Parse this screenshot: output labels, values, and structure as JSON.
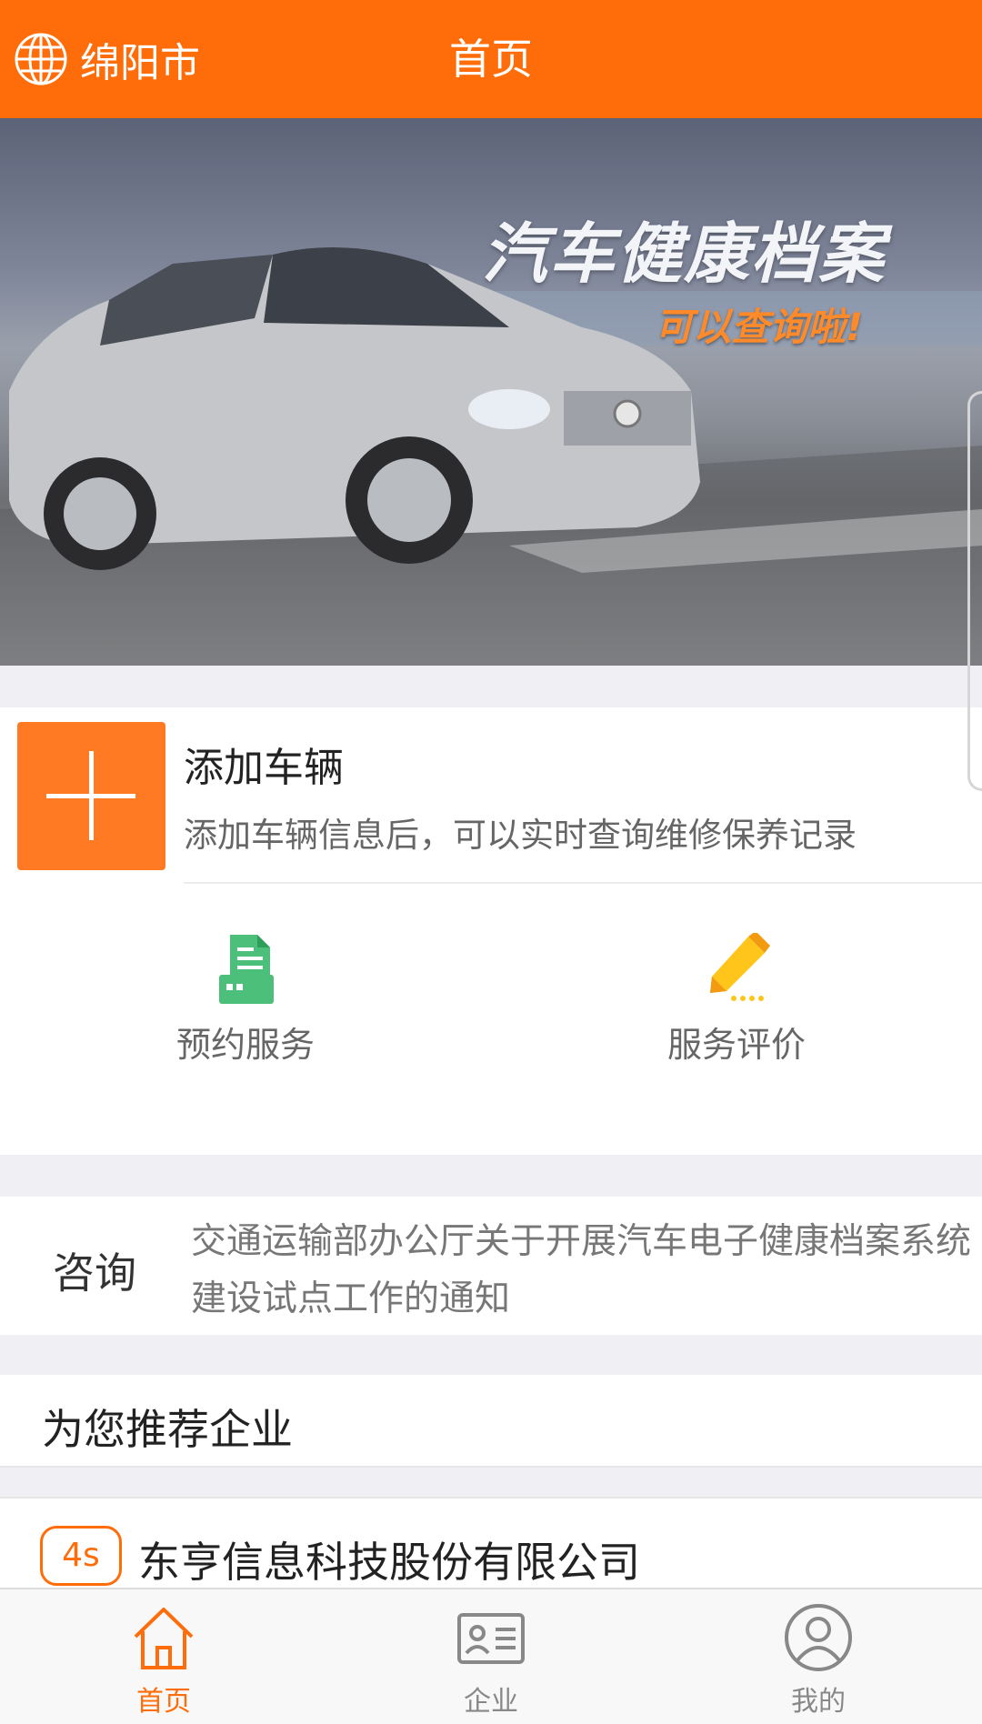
{
  "header": {
    "city": "绵阳市",
    "title": "首页"
  },
  "banner": {
    "headline": "汽车健康档案",
    "subline": "可以查询啦!"
  },
  "add_vehicle": {
    "title": "添加车辆",
    "description": "添加车辆信息后，可以实时查询维修保养记录"
  },
  "services": [
    {
      "label": "预约服务",
      "icon": "booking-document-icon",
      "color": "#4cc07a"
    },
    {
      "label": "服务评价",
      "icon": "pencil-icon",
      "color": "#ffc51a"
    }
  ],
  "news": {
    "label": "咨询",
    "text": "交通运输部办公厅关于开展汽车电子健康档案系统建设试点工作的通知"
  },
  "recommend": {
    "title": "为您推荐企业",
    "companies": [
      {
        "badge": "4s",
        "name": "东亨信息科技股份有限公司"
      }
    ]
  },
  "tabbar": {
    "items": [
      {
        "label": "首页",
        "icon": "home-icon",
        "active": true
      },
      {
        "label": "企业",
        "icon": "business-card-icon",
        "active": false
      },
      {
        "label": "我的",
        "icon": "user-icon",
        "active": false
      }
    ]
  },
  "colors": {
    "accent": "#ff6d0a",
    "booking_green": "#4cc07a",
    "rating_yellow": "#ffc51a"
  }
}
